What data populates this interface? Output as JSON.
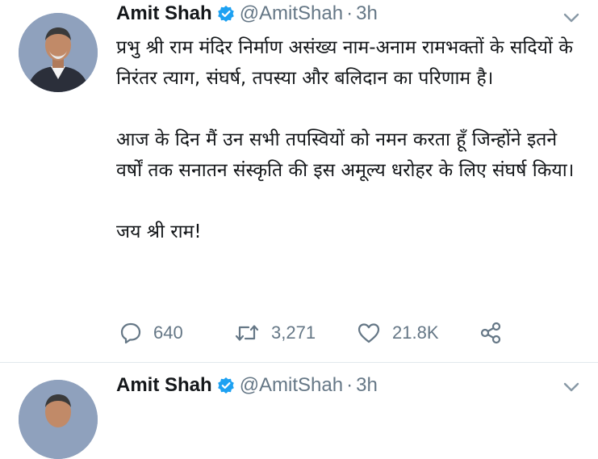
{
  "tweets": [
    {
      "author": {
        "name": "Amit Shah",
        "handle": "@AmitShah"
      },
      "separator": "·",
      "time": "3h",
      "paragraphs": [
        "प्रभु श्री राम मंदिर निर्माण असंख्य नाम-अनाम रामभक्तों के सदियों के निरंतर त्याग, संघर्ष, तपस्या और बलिदान का परिणाम है।",
        "आज के दिन मैं उन सभी तपस्वियों को नमन करता हूँ जिन्होंने इतने वर्षों तक सनातन संस्कृति की इस अमूल्य धरोहर के लिए संघर्ष किया।",
        "जय श्री राम!"
      ],
      "stats": {
        "replies": "640",
        "retweets": "3,271",
        "likes": "21.8K"
      },
      "icons": {
        "reply": "reply-icon",
        "retweet": "retweet-icon",
        "like": "heart-icon",
        "share": "share-icon",
        "verified": "verified-badge-icon",
        "menu": "chevron-down-icon"
      }
    },
    {
      "author": {
        "name": "Amit Shah",
        "handle": "@AmitShah"
      },
      "separator": "·",
      "time": "3h"
    }
  ],
  "colors": {
    "text": "#14171a",
    "secondary": "#657786",
    "verified": "#1da1f2",
    "divider": "#e1e8ed"
  }
}
